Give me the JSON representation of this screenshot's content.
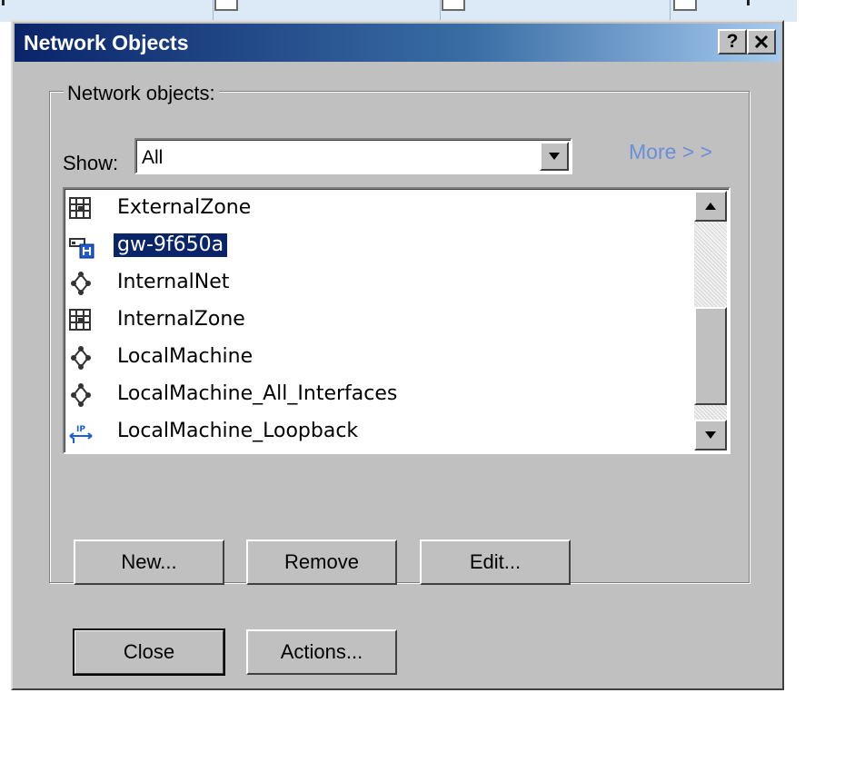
{
  "window": {
    "title": "Network Objects",
    "help_button": "?",
    "close_button": "✕"
  },
  "group": {
    "legend": "Network objects:"
  },
  "filter": {
    "label": "Show:",
    "selected": "All"
  },
  "more_link": "More > >",
  "list": {
    "items": [
      {
        "label": "ExternalZone",
        "icon": "zone-icon",
        "selected": false
      },
      {
        "label": "gw-9f650a",
        "icon": "gateway-icon",
        "selected": true
      },
      {
        "label": "InternalNet",
        "icon": "network-icon",
        "selected": false
      },
      {
        "label": "InternalZone",
        "icon": "zone-icon",
        "selected": false
      },
      {
        "label": "LocalMachine",
        "icon": "network-icon",
        "selected": false
      },
      {
        "label": "LocalMachine_All_Interfaces",
        "icon": "network-icon",
        "selected": false
      },
      {
        "label": "LocalMachine_Loopback",
        "icon": "ip-loopback-icon",
        "selected": false
      }
    ]
  },
  "buttons": {
    "new": "New...",
    "remove": "Remove",
    "edit": "Edit...",
    "close": "Close",
    "actions": "Actions..."
  },
  "colors": {
    "titlebar_start": "#0a246a",
    "titlebar_end": "#a6caf0",
    "dialog_face": "#c0c0c0",
    "selection": "#0a246a",
    "more_link": "#6a8fd8"
  }
}
